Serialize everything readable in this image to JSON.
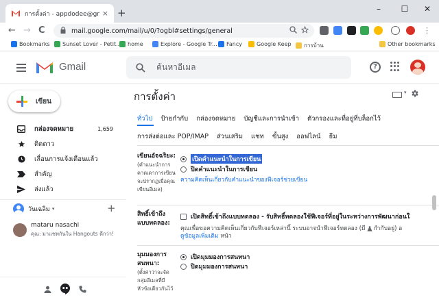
{
  "browser": {
    "tab_title": "การตั้งค่า - appdodee@gmail.com",
    "tab_close": "×",
    "new_tab": "+",
    "minimize": "–",
    "maximize": "☐",
    "close": "✕",
    "back": "←",
    "forward": "→",
    "reload": "C",
    "url": "mail.google.com/mail/u/0/?ogbl#settings/general",
    "bookmarks": [
      {
        "label": "Bookmarks",
        "color": "#1a73e8"
      },
      {
        "label": "Sunset Lover - Petit...",
        "color": "#34a853"
      },
      {
        "label": "home",
        "color": "#34a853"
      },
      {
        "label": "Explore - Google Tr...",
        "color": "#4285f4"
      },
      {
        "label": "Fancy",
        "color": "#1a73e8"
      },
      {
        "label": "Google Keep",
        "color": "#fbbc04"
      },
      {
        "label": "การบ้าน",
        "color": "#f4c542"
      }
    ],
    "other_bookmarks": "Other bookmarks"
  },
  "gmail": {
    "brand": "Gmail",
    "search_placeholder": "ค้นหาอีเมล"
  },
  "sidebar": {
    "compose_label": "เขียน",
    "items": [
      {
        "label": "กล่องจดหมาย",
        "count": "1,659",
        "bold": true,
        "icon": "inbox-icon"
      },
      {
        "label": "ติดดาว",
        "count": "",
        "bold": false,
        "icon": "star-icon"
      },
      {
        "label": "เลื่อนการแจ้งเตือนแล้ว",
        "count": "",
        "bold": false,
        "icon": "clock-icon"
      },
      {
        "label": "สำคัญ",
        "count": "",
        "bold": false,
        "icon": "important-icon"
      },
      {
        "label": "ส่งแล้ว",
        "count": "",
        "bold": false,
        "icon": "send-icon"
      }
    ],
    "hangouts_user": "วันเฉลิม",
    "contact_name": "mataru nasachi",
    "contact_status": "คุณ: มาแชทกันใน Hangouts ดีกว่า!"
  },
  "settings": {
    "title": "การตั้งค่า",
    "tabs_row1": [
      "ทั่วไป",
      "ป้ายกำกับ",
      "กล่องจดหมาย",
      "บัญชีและการนำเข้า",
      "ตัวกรองและที่อยู่ที่บล็อกไว้"
    ],
    "tabs_row2": [
      "การส่งต่อและ POP/IMAP",
      "ส่วนเสริม",
      "แชท",
      "ขั้นสูง",
      "ออฟไลน์",
      "ธีม"
    ],
    "smart_compose": {
      "title": "เขียนอัจฉริยะ:",
      "desc_lines": [
        "(คำแนะนำการ",
        "คาดเดาการเขียน",
        "จะปรากฏเมื่อคุณ",
        "เขียนอีเมล)"
      ],
      "option_on": "เปิดคำแนะนำในการเขียน",
      "option_off": "ปิดคำแนะนำในการเขียน",
      "feedback_link": "ความคิดเห็นเกี่ยวกับคำแนะนำของฟีเจอร์ช่วยเขียน"
    },
    "experimental": {
      "title_lines": [
        "สิทธิ์เข้าถึง",
        "แบบทดลอง:"
      ],
      "checkbox_label": "เปิดสิทธิ์เข้าถึงแบบทดลอง - รับสิทธิ์ทดลองใช้ฟีเจอร์ที่อยู่ในระหว่างการพัฒนาก่อนใ",
      "desc": "คุณเพื่อขอความคิดเห็นเกี่ยวกับฟีเจอร์เหล่านี้ ระบบอาจนำฟีเจอร์ทดลอง (มี",
      "desc_tail": "กำกับอยู่) อ",
      "learn_more": "ดูข้อมูลเพิ่มเติม",
      "page_word": "หน้า"
    },
    "conversation_view": {
      "title_lines": [
        "มุมมองการ",
        "สนทนา:"
      ],
      "desc_lines": [
        "(ตั้งค่าว่าจะจัด",
        "กลุ่มอีเมลที่มี",
        "หัวข้อเดียวกันไว้"
      ],
      "option_on": "เปิดมุมมองการสนทนา",
      "option_off": "ปิดมุมมองการสนทนา"
    }
  },
  "colors": {
    "gmail_red": "#ea4335",
    "link_blue": "#1a73e8",
    "selection": "#3367d6"
  }
}
